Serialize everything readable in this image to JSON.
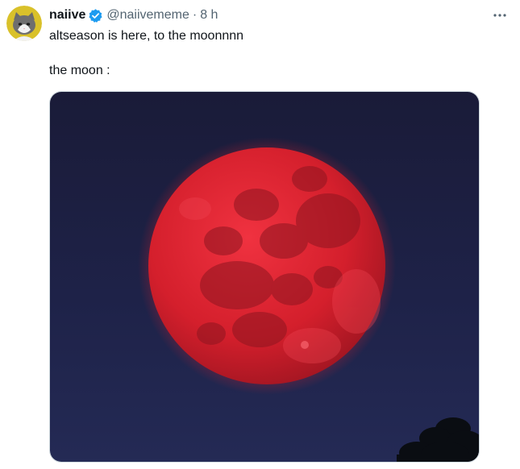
{
  "tweet": {
    "author": {
      "display_name": "naiive",
      "handle": "@naiivememe",
      "verified": true,
      "avatar_icon": "cat-avatar-icon"
    },
    "separator": "·",
    "timestamp": "8 h",
    "text_line_1": "altseason is here, to the moonnnn",
    "text_line_2": "the moon :",
    "more_icon": "more-options-icon",
    "media": {
      "icon": "red-moon-photo",
      "colors": {
        "sky": "#1d2040",
        "moon": "#d41f2c"
      }
    }
  },
  "colors": {
    "text": "#0f1419",
    "secondary": "#536471",
    "verified_badge": "#1d9bf0"
  }
}
